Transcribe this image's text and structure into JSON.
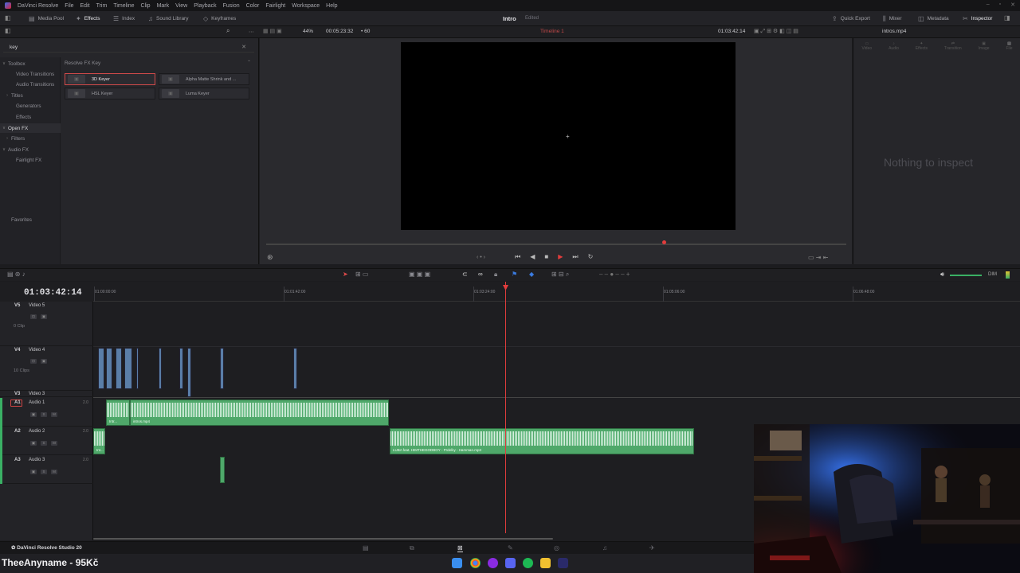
{
  "menubar": {
    "app_name": "DaVinci Resolve",
    "items": [
      "File",
      "Edit",
      "Trim",
      "Timeline",
      "Clip",
      "Mark",
      "View",
      "Playback",
      "Fusion",
      "Color",
      "Fairlight",
      "Workspace",
      "Help"
    ]
  },
  "toolbar": {
    "media_pool": "Media Pool",
    "effects": "Effects",
    "index": "Index",
    "sound_library": "Sound Library",
    "keyframes": "Keyframes",
    "project_title": "Intro",
    "project_status": "Edited",
    "quick_export": "Quick Export",
    "mixer": "Mixer",
    "metadata": "Metadata",
    "inspector": "Inspector"
  },
  "viewer_bar": {
    "zoom": "44%",
    "duration": "00:05:23:32",
    "fps": "60",
    "timeline_name": "Timeline 1",
    "timecode": "01:03:42:14",
    "inspector_clip": "intros.mp4"
  },
  "effects_panel": {
    "search_value": "key",
    "tree": [
      {
        "label": "Toolbox",
        "caret": "∨"
      },
      {
        "label": "Video Transitions",
        "caret": ""
      },
      {
        "label": "Audio Transitions",
        "caret": ""
      },
      {
        "label": "Titles",
        "caret": "›"
      },
      {
        "label": "Generators",
        "caret": ""
      },
      {
        "label": "Effects",
        "caret": ""
      },
      {
        "label": "Open FX",
        "caret": "∨"
      },
      {
        "label": "Filters",
        "caret": "›"
      },
      {
        "label": "Audio FX",
        "caret": "∨"
      },
      {
        "label": "Fairlight FX",
        "caret": ""
      },
      {
        "label": "Favorites",
        "caret": ""
      }
    ],
    "group_title": "Resolve FX Key",
    "tiles": [
      "3D Keyer",
      "Alpha Matte Shrink and ...",
      "HSL Keyer",
      "Luma Keyer"
    ]
  },
  "inspector": {
    "tabs": [
      "Video",
      "Audio",
      "Effects",
      "Transition",
      "Image",
      "File"
    ],
    "empty_message": "Nothing to inspect"
  },
  "timeline": {
    "current_timecode": "01:03:42:14",
    "ruler_labels": [
      "01:00:00:00",
      "01:01:42:00",
      "01:03:24:00",
      "01:05:06:00",
      "01:06:48:00"
    ],
    "tracks": [
      {
        "id": "V5",
        "name": "Video 5",
        "count": "0 Clip"
      },
      {
        "id": "V4",
        "name": "Video 4",
        "count": "10 Clips"
      },
      {
        "id": "V3",
        "name": "Video 3",
        "count": ""
      },
      {
        "id": "A1",
        "name": "Audio 1",
        "vol": "2.0"
      },
      {
        "id": "A2",
        "name": "Audio 2",
        "vol": "2.0"
      },
      {
        "id": "A3",
        "name": "Audio 3",
        "vol": "2.0"
      }
    ],
    "audio_clips": {
      "a1_small": "Intr...",
      "a1_main": "intros.mp4",
      "a2_small": "Int...",
      "a2_main": "LUBA feat. HIMTHEGODBOY - Prdelky - Hamman.mp3"
    },
    "dim_label": "DIM"
  },
  "pagebar": {
    "brand": "DaVinci Resolve Studio 20"
  },
  "taskbar": {
    "streamer_overlay": "TheeAnyname - 95Kč"
  }
}
